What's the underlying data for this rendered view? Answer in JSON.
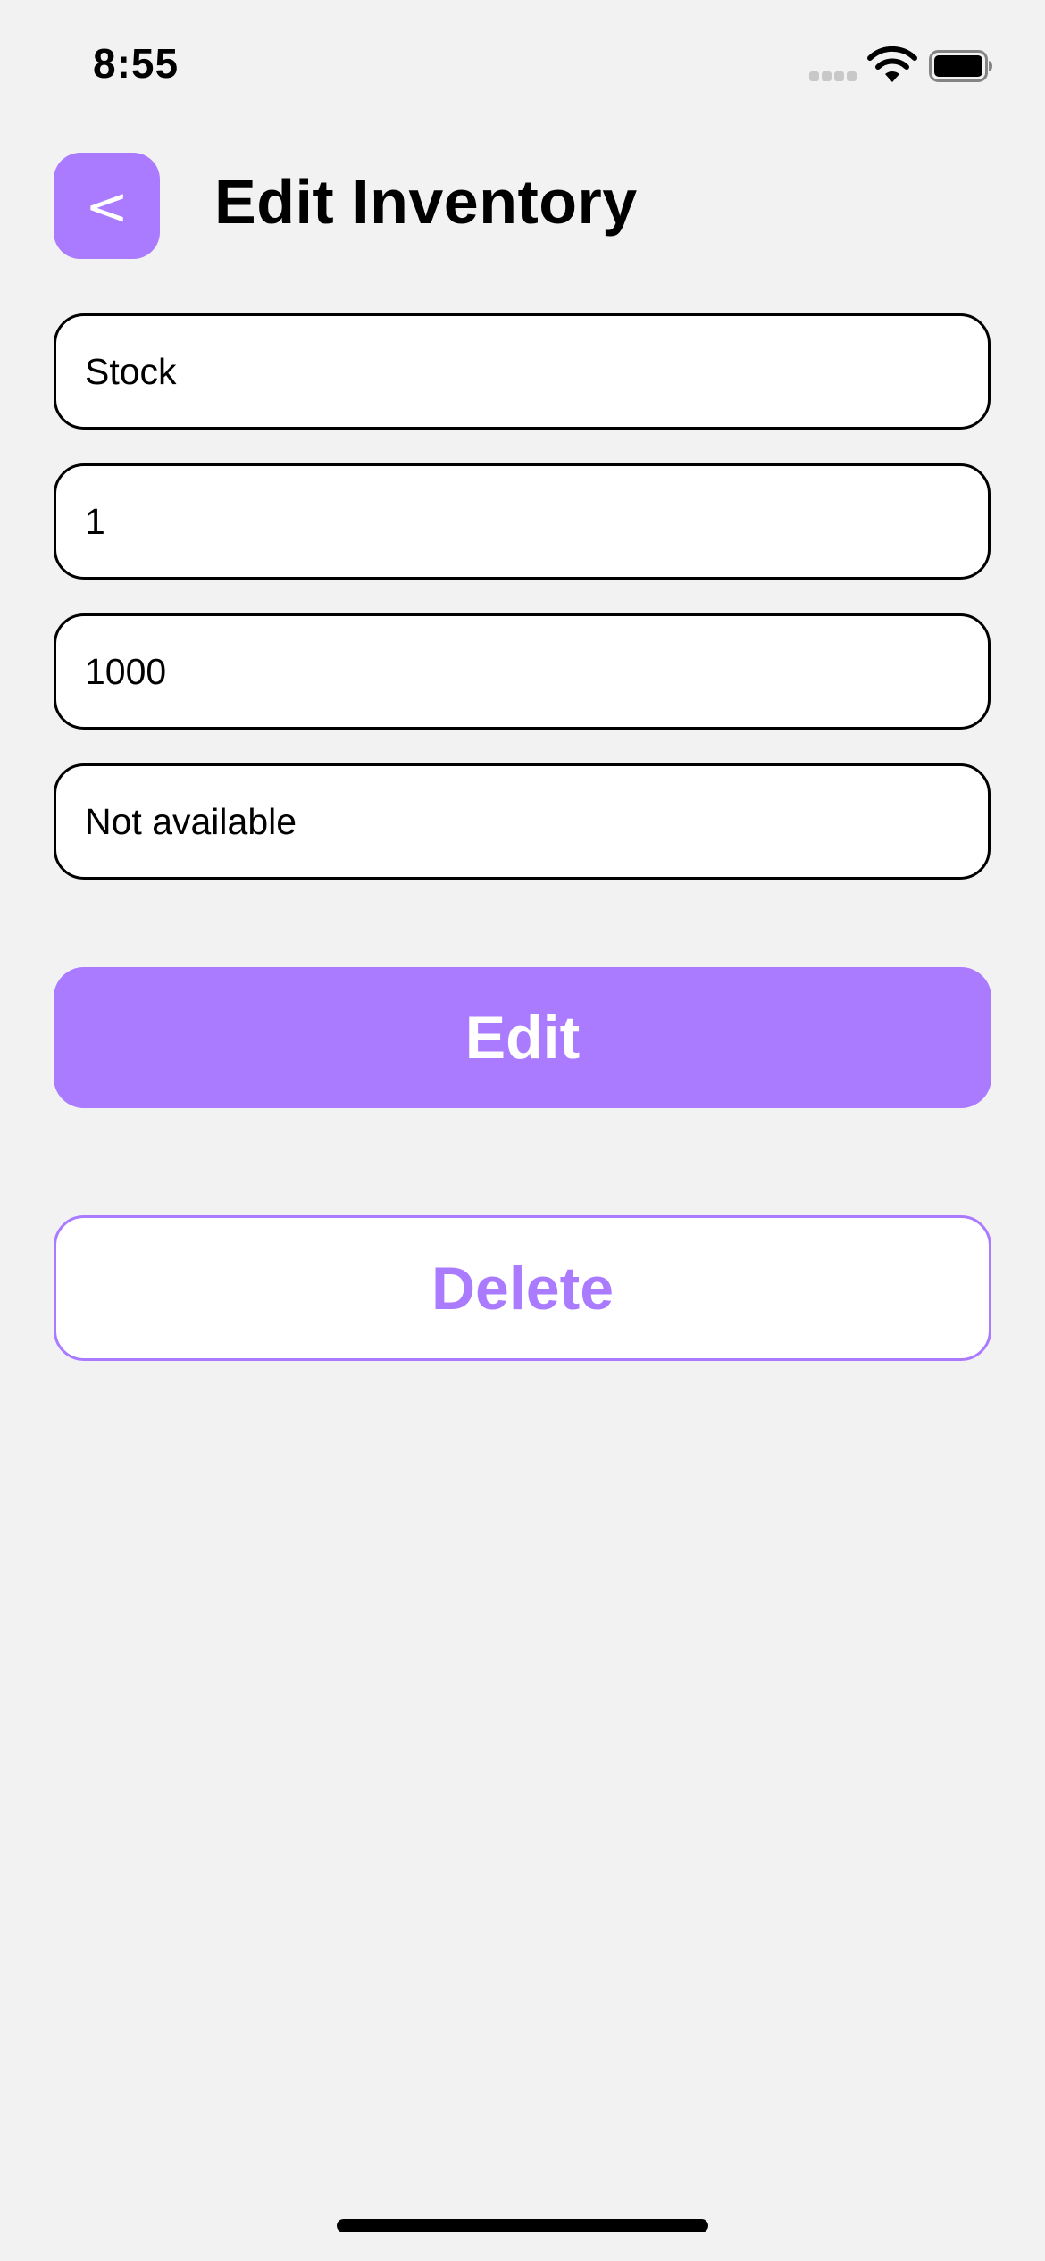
{
  "status_bar": {
    "time": "8:55"
  },
  "header": {
    "back_label": "<",
    "title": "Edit Inventory"
  },
  "form": {
    "fields": [
      {
        "value": "Stock"
      },
      {
        "value": "1"
      },
      {
        "value": "1000"
      },
      {
        "value": "Not available"
      }
    ]
  },
  "actions": {
    "edit_label": "Edit",
    "delete_label": "Delete"
  },
  "colors": {
    "accent": "#aa7bff",
    "background": "#f2f2f2"
  }
}
